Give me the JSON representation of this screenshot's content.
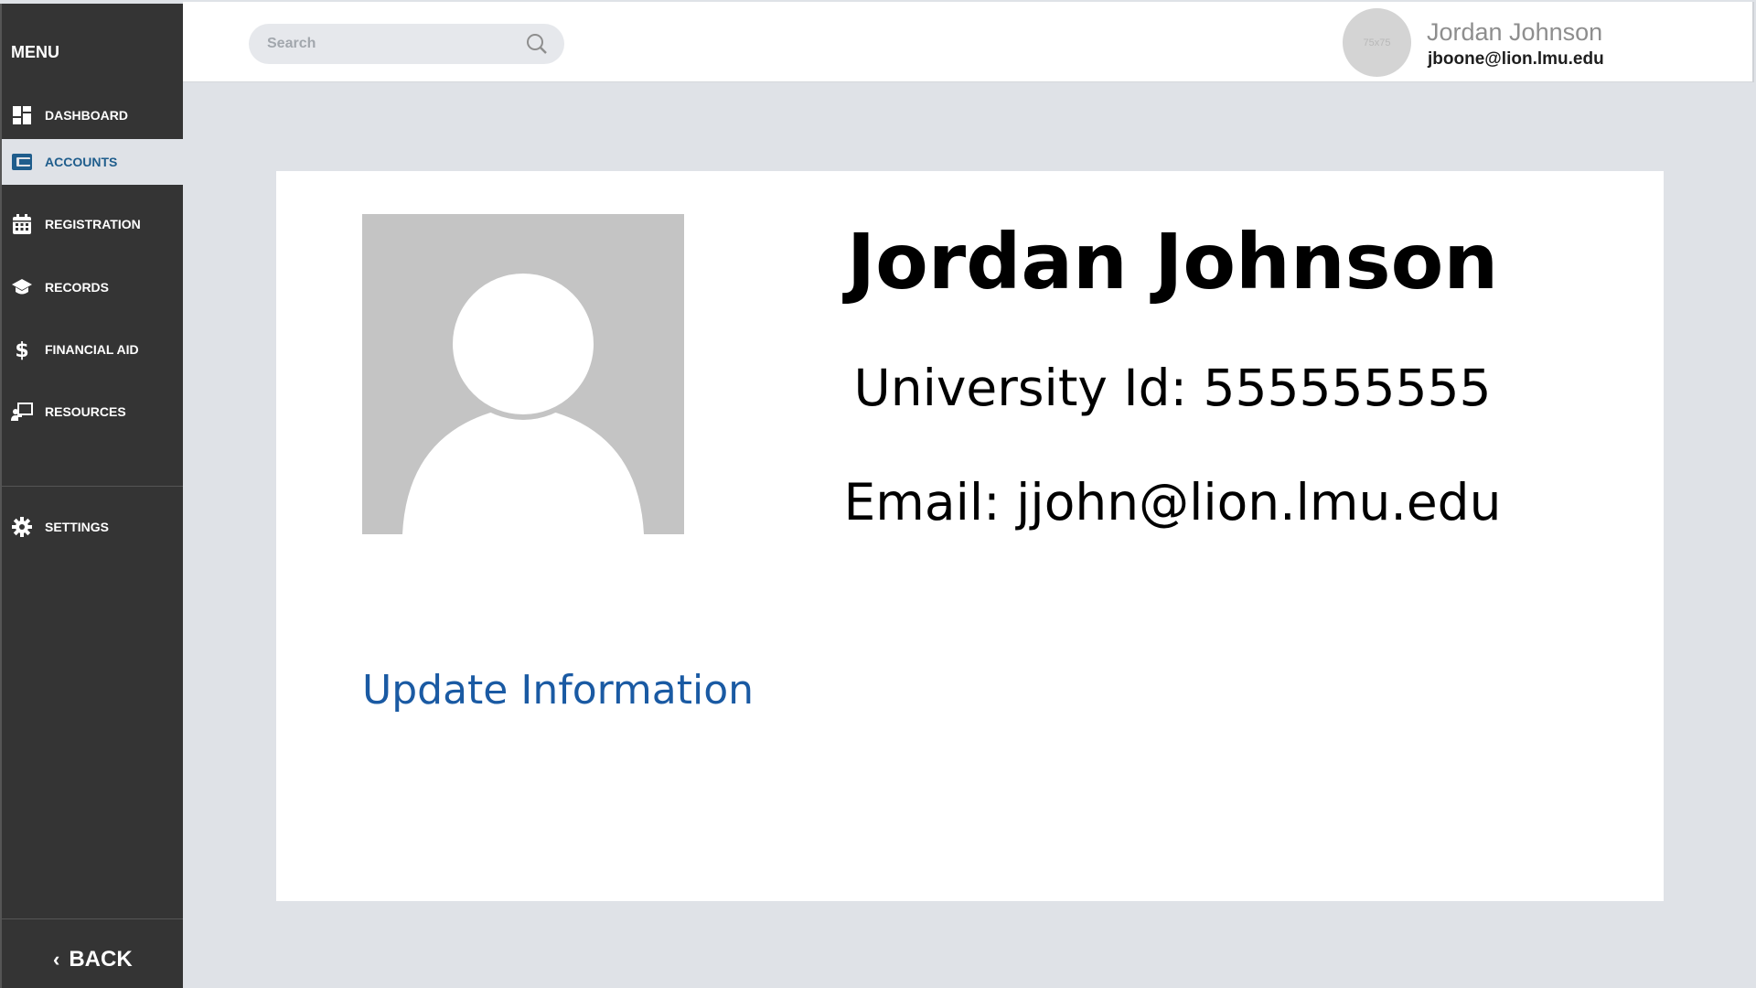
{
  "sidebar": {
    "title": "MENU",
    "items": [
      {
        "label": "DASHBOARD",
        "icon": "dashboard-icon"
      },
      {
        "label": "ACCOUNTS",
        "icon": "wallet-icon",
        "active": true
      },
      {
        "label": "REGISTRATION",
        "icon": "calendar-icon"
      },
      {
        "label": "RECORDS",
        "icon": "graduation-cap-icon"
      },
      {
        "label": "FINANCIAL AID",
        "icon": "dollar-icon"
      },
      {
        "label": "RESOURCES",
        "icon": "teacher-board-icon"
      }
    ],
    "settings_label": "SETTINGS",
    "back_label": "BACK"
  },
  "header": {
    "search_placeholder": "Search",
    "avatar_placeholder": "75x75",
    "user_name": "Jordan Johnson",
    "user_email": "jboone@lion.lmu.edu"
  },
  "profile": {
    "name": "Jordan Johnson",
    "university_id_line": "University Id: 555555555",
    "email_line": "Email: jjohn@lion.lmu.edu",
    "update_link": "Update Information"
  },
  "colors": {
    "sidebar_bg": "#343434",
    "page_bg": "#dfe2e7",
    "active_text": "#1f5d8c",
    "link": "#1a5aa3"
  }
}
